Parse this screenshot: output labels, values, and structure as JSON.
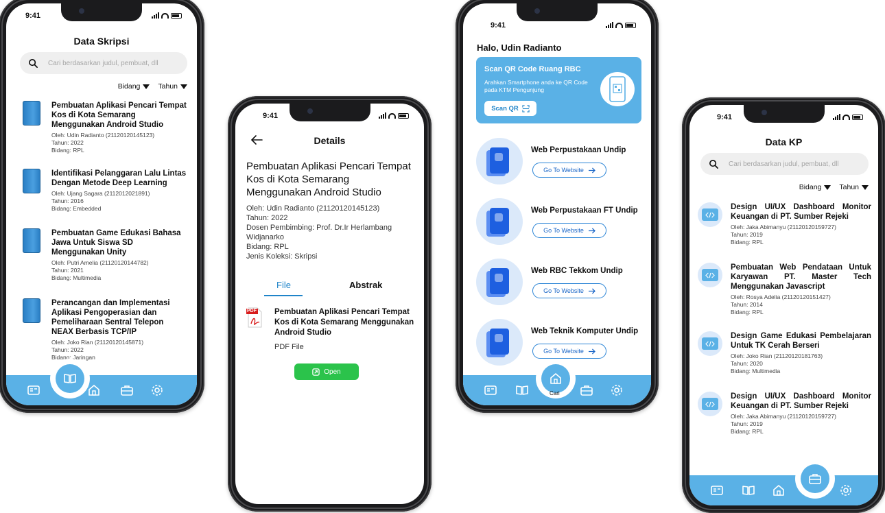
{
  "phone1": {
    "time": "9:41",
    "title": "Data Skripsi",
    "search_placeholder": "Cari berdasarkan judul, pembuat, dll",
    "filter_bidang": "Bidang",
    "filter_tahun": "Tahun",
    "items": [
      {
        "title": "Pembuatan Aplikasi Pencari Tempat Kos di Kota Semarang Menggunakan Android Studio",
        "author": "Oleh: Udin Radianto (21120120145123)",
        "year": "Tahun: 2022",
        "field": "Bidang: RPL"
      },
      {
        "title": "Identifikasi Pelanggaran Lalu Lintas Dengan Metode Deep Learning",
        "author": "Oleh: Ujang Sagara (2112012021891)",
        "year": "Tahun: 2016",
        "field": "Bidang: Embedded"
      },
      {
        "title": "Pembuatan Game Edukasi  Bahasa Jawa Untuk Siswa SD Menggunakan Unity",
        "author": "Oleh: Putri Amelia (21120120144782)",
        "year": "Tahun: 2021",
        "field": "Bidang: Multimedia"
      },
      {
        "title": "Perancangan dan Implementasi Aplikasi Pengoperasian dan Pemeliharaan Sentral Telepon NEAX Berbasis TCP/IP",
        "author": "Oleh: Joko Rian (21120120145871)",
        "year": "Tahun: 2022",
        "field": "Bidang: Jaringan"
      }
    ]
  },
  "phone2": {
    "time": "9:41",
    "title": "Details",
    "doc_title": "Pembuatan Aplikasi Pencari Tempat Kos di Kota Semarang Menggunakan Android Studio",
    "author": "Oleh: Udin Radianto (21120120145123)",
    "year": "Tahun: 2022",
    "advisor": "Dosen Pembimbing:  Prof. Dr.Ir Herlambang Widjanarko",
    "field": "Bidang: RPL",
    "collection": "Jenis Koleksi: Skripsi",
    "tab_file": "File",
    "tab_abstract": "Abstrak",
    "file_name": "Pembuatan Aplikasi Pencari Tempat Kos di Kota Semarang Menggunakan Android Studio",
    "file_type": "PDF File",
    "pdf_badge": "PDF",
    "open_label": "Open"
  },
  "phone3": {
    "time": "9:41",
    "greeting": "Halo, Udin Radianto",
    "banner_title": "Scan QR Code Ruang RBC",
    "banner_text": "Arahkan Smartphone anda ke QR Code pada KTM Pengunjung",
    "scan_label": "Scan QR",
    "goto_label": "Go To Website",
    "websites": [
      "Web Perpustakaan Undip",
      "Web Perpustakaan FT Undip",
      "Web RBC Tekkom Undip",
      "Web Teknik Komputer Undip"
    ],
    "nav_partial_label": "Cari"
  },
  "phone4": {
    "time": "9:41",
    "title": "Data KP",
    "search_placeholder": "Cari berdasarkan judul, pembuat, dll",
    "filter_bidang": "Bidang",
    "filter_tahun": "Tahun",
    "items": [
      {
        "title": "Design UI/UX Dashboard Monitor Keuangan di PT. Sumber Rejeki",
        "author": "Oleh: Jaka Abimanyu (21120120159727)",
        "year": "Tahun: 2019",
        "field": "Bidang: RPL"
      },
      {
        "title": "Pembuatan Web Pendataan Untuk Karyawan PT. Master Tech Menggunakan Javascript",
        "author": "Oleh: Rosya Adelia (21120120151427)",
        "year": "Tahun: 2014",
        "field": "Bidang: RPL"
      },
      {
        "title": "Design Game Edukasi Pembelajaran Untuk TK Cerah Berseri",
        "author": "Oleh: Joko Rian (21120120181763)",
        "year": "Tahun: 2020",
        "field": "Bidang: Multimedia"
      },
      {
        "title": "Design UI/UX Dashboard Monitor Keuangan di PT. Sumber Rejeki",
        "author": "Oleh: Jaka Abimanyu (21120120159727)",
        "year": "Tahun: 2019",
        "field": "Bidang: RPL"
      }
    ]
  },
  "colors": {
    "primary": "#5ab1e6",
    "accent_blue": "#1f84c9",
    "open_green": "#2bc34b",
    "book_blue": "#1d5fe0"
  },
  "icons": [
    "search-icon",
    "book-icon",
    "home-icon",
    "briefcase-icon",
    "gear-icon",
    "card-icon",
    "back-arrow-icon",
    "pdf-icon",
    "qr-icon",
    "arrow-right-icon",
    "code-icon"
  ]
}
